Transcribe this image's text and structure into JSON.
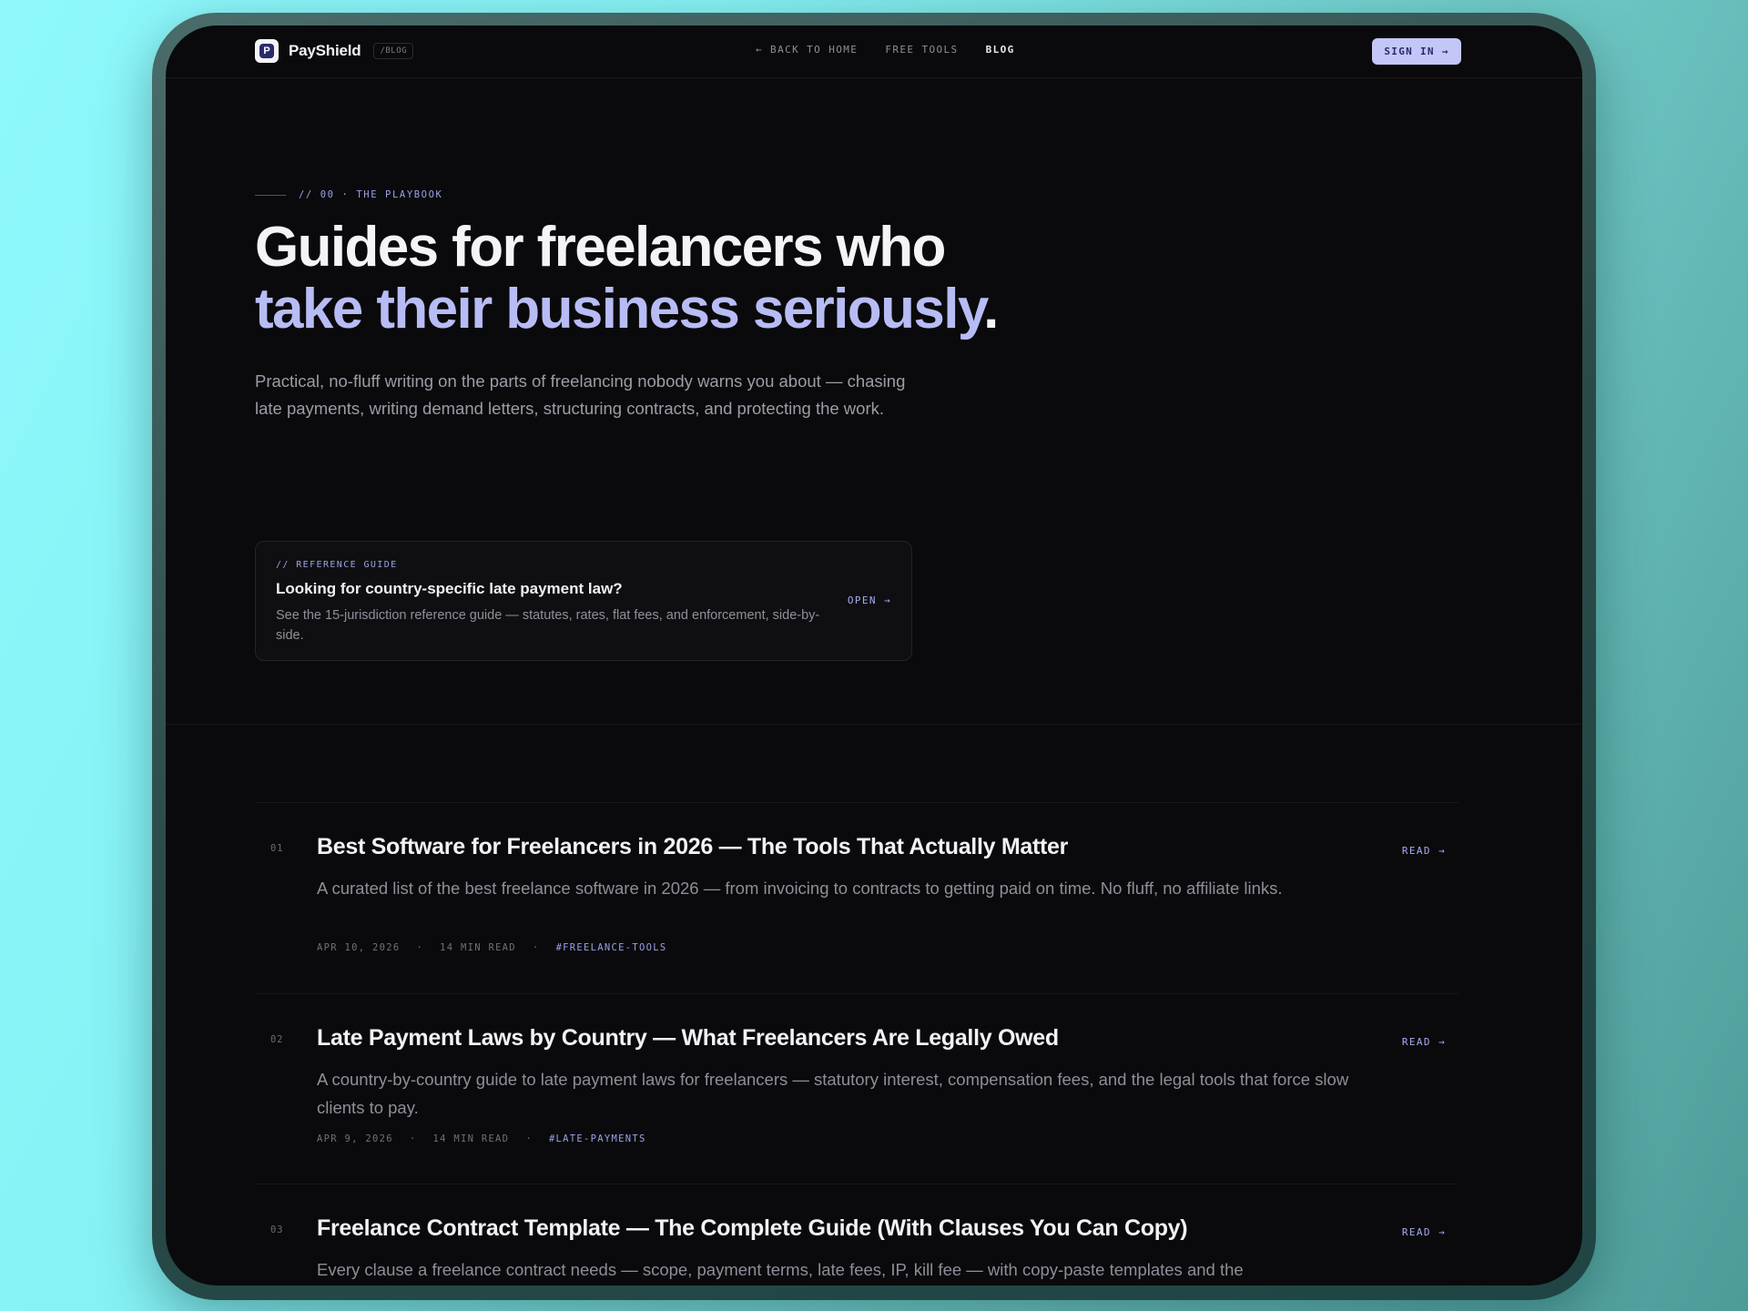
{
  "nav": {
    "brand": "PayShield",
    "brand_letter": "P",
    "section_tag": "/BLOG",
    "links": [
      {
        "label": "← BACK TO HOME"
      },
      {
        "label": "FREE TOOLS"
      },
      {
        "label": "BLOG"
      }
    ],
    "signin_label": "SIGN IN →"
  },
  "hero": {
    "eyebrow": "// 00 · THE PLAYBOOK",
    "title_line1": "Guides for freelancers who",
    "title_accent": "take their business seriously",
    "title_end": ".",
    "subtitle": "Practical, no-fluff writing on the parts of freelancing nobody warns you about — chasing late payments, writing demand letters, structuring contracts, and protecting the work."
  },
  "reference": {
    "eyebrow": "// REFERENCE GUIDE",
    "title": "Looking for country-specific late payment law?",
    "description": "See the 15-jurisdiction reference guide — statutes, rates, flat fees, and enforcement, side-by-side.",
    "open_label": "OPEN →"
  },
  "posts": [
    {
      "num": "01",
      "title": "Best Software for Freelancers in 2026 — The Tools That Actually Matter",
      "description": "A curated list of the best freelance software in 2026 — from invoicing to contracts to getting paid on time. No fluff, no affiliate links.",
      "date": "APR 10, 2026",
      "read_time": "14 MIN READ",
      "tag": "#FREELANCE-TOOLS",
      "read_label": "READ →"
    },
    {
      "num": "02",
      "title": "Late Payment Laws by Country — What Freelancers Are Legally Owed",
      "description": "A country-by-country guide to late payment laws for freelancers — statutory interest, compensation fees, and the legal tools that force slow clients to pay.",
      "date": "APR 9, 2026",
      "read_time": "14 MIN READ",
      "tag": "#LATE-PAYMENTS",
      "read_label": "READ →"
    },
    {
      "num": "03",
      "title": "Freelance Contract Template — The Complete Guide (With Clauses You Can Copy)",
      "description": "Every clause a freelance contract needs — scope, payment terms, late fees, IP, kill fee — with copy-paste templates and the",
      "read_label": "READ →"
    }
  ],
  "meta_separator": "·",
  "colors": {
    "accent": "#b8bcf5",
    "background": "#0a0a0c",
    "signin_bg": "#c3c6f7"
  }
}
